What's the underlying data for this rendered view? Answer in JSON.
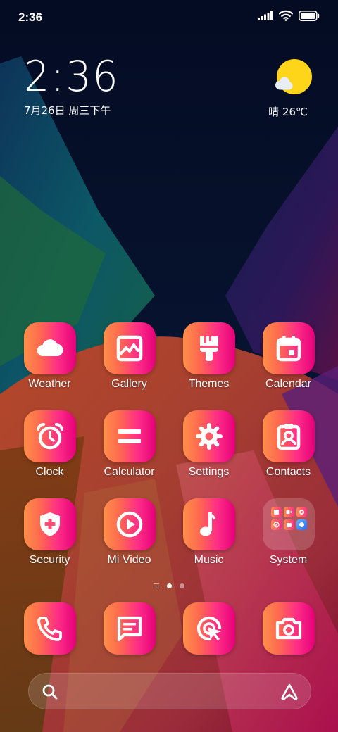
{
  "status_bar": {
    "time": "2:36",
    "icons": [
      "signal-icon",
      "wifi-icon",
      "battery-icon"
    ]
  },
  "clock_widget": {
    "time": "2:36",
    "date": "7月26日 周三下午"
  },
  "weather_widget": {
    "icon": "sun-cloud-icon",
    "text": "晴 26℃"
  },
  "apps": [
    {
      "label": "Weather",
      "icon": "cloud-icon"
    },
    {
      "label": "Gallery",
      "icon": "image-icon"
    },
    {
      "label": "Themes",
      "icon": "paintbrush-icon"
    },
    {
      "label": "Calendar",
      "icon": "calendar-icon"
    },
    {
      "label": "Clock",
      "icon": "alarm-clock-icon"
    },
    {
      "label": "Calculator",
      "icon": "equals-icon"
    },
    {
      "label": "Settings",
      "icon": "gear-icon"
    },
    {
      "label": "Contacts",
      "icon": "contact-card-icon"
    },
    {
      "label": "Security",
      "icon": "shield-plus-icon"
    },
    {
      "label": "Mi Video",
      "icon": "play-circle-icon"
    },
    {
      "label": "Music",
      "icon": "music-note-icon"
    },
    {
      "label": "System",
      "icon": "folder-icon"
    }
  ],
  "page_indicator": {
    "pages": 2,
    "current": 1
  },
  "dock": [
    {
      "icon": "phone-icon"
    },
    {
      "icon": "message-icon"
    },
    {
      "icon": "browser-cursor-icon"
    },
    {
      "icon": "camera-icon"
    }
  ],
  "search_bar": {
    "left_icon": "search-icon",
    "right_icon": "assistant-icon"
  },
  "colors": {
    "icon_gradient_start": "#ff8f4a",
    "icon_gradient_end": "#e5007a",
    "background_top": "#061029"
  }
}
